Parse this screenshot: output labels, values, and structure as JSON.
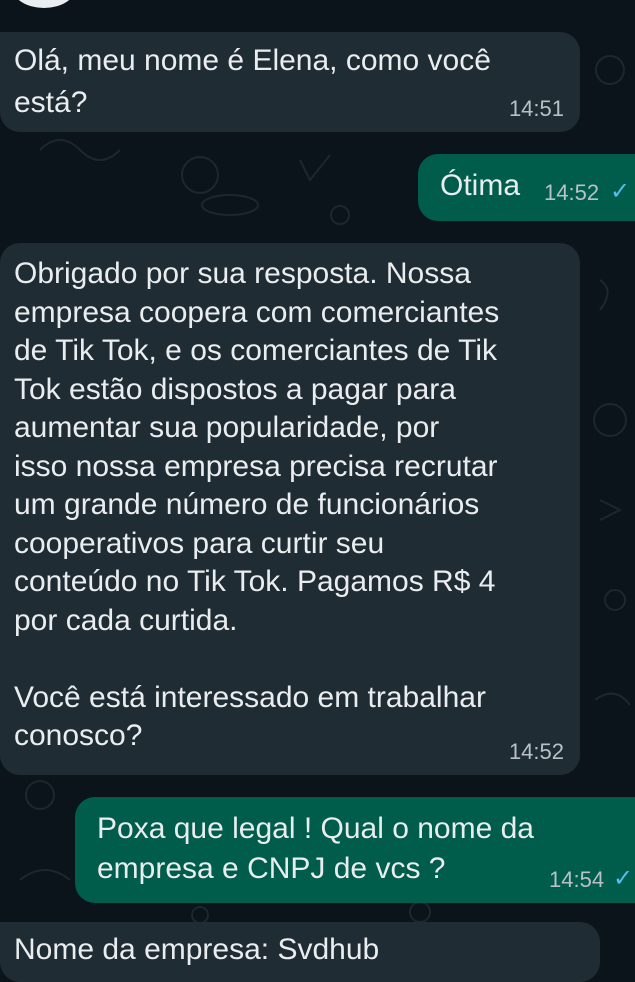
{
  "messages": [
    {
      "direction": "incoming",
      "text": "Olá, meu nome é Elena, como você\nestá?",
      "time": "14:51"
    },
    {
      "direction": "outgoing",
      "text": "Ótima",
      "time": "14:52",
      "status_icon": "read-check-icon"
    },
    {
      "direction": "incoming",
      "text": "Obrigado por sua resposta. Nossa\nempresa coopera com comerciantes\nde Tik Tok, e os comerciantes de Tik\nTok estão dispostos a pagar para\naumentar sua popularidade, por\nisso nossa empresa precisa recrutar\num grande número de funcionários\ncooperativos para curtir seu\nconteúdo no Tik Tok. Pagamos R$ 4\npor cada curtida.\n\nVocê está interessado em trabalhar\nconosco?",
      "time": "14:52"
    },
    {
      "direction": "outgoing",
      "text": "Poxa que legal ! Qual o nome da\nempresa e CNPJ de vcs ?",
      "time": "14:54",
      "status_icon": "read-check-icon"
    },
    {
      "direction": "incoming",
      "text": "Nome da empresa: Svdhub"
    }
  ],
  "colors": {
    "background": "#0b141a",
    "incoming_bubble": "#202c33",
    "outgoing_bubble": "#005c4b",
    "text": "#e9edef",
    "time": "#b8c1c6",
    "tick": "#53bdeb"
  }
}
